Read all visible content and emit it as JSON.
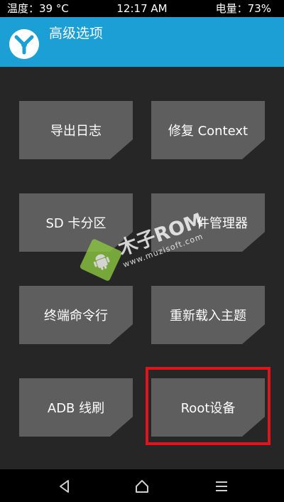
{
  "status_bar": {
    "temperature": "温度：39 °C",
    "time": "12:17 AM",
    "battery": "电量：73%"
  },
  "header": {
    "title": "高级选项",
    "logo_icon": "twrp-logo-icon",
    "color": "#1b9fd4"
  },
  "buttons": [
    {
      "label": "导出日志"
    },
    {
      "label": "修复 Context"
    },
    {
      "label": "SD 卡分区"
    },
    {
      "label": "件管理器"
    },
    {
      "label": "终端命令行"
    },
    {
      "label": "重新载入主题"
    },
    {
      "label": "ADB 线刷"
    },
    {
      "label": "Root设备"
    }
  ],
  "highlight": {
    "target": "Root设备",
    "color": "#e0141a"
  },
  "watermark": {
    "brand": "木子ROM",
    "url": "www.muzisoft.com"
  },
  "nav_bar": {
    "back_icon": "back-triangle-icon",
    "home_icon": "home-icon",
    "menu_icon": "menu-icon"
  }
}
